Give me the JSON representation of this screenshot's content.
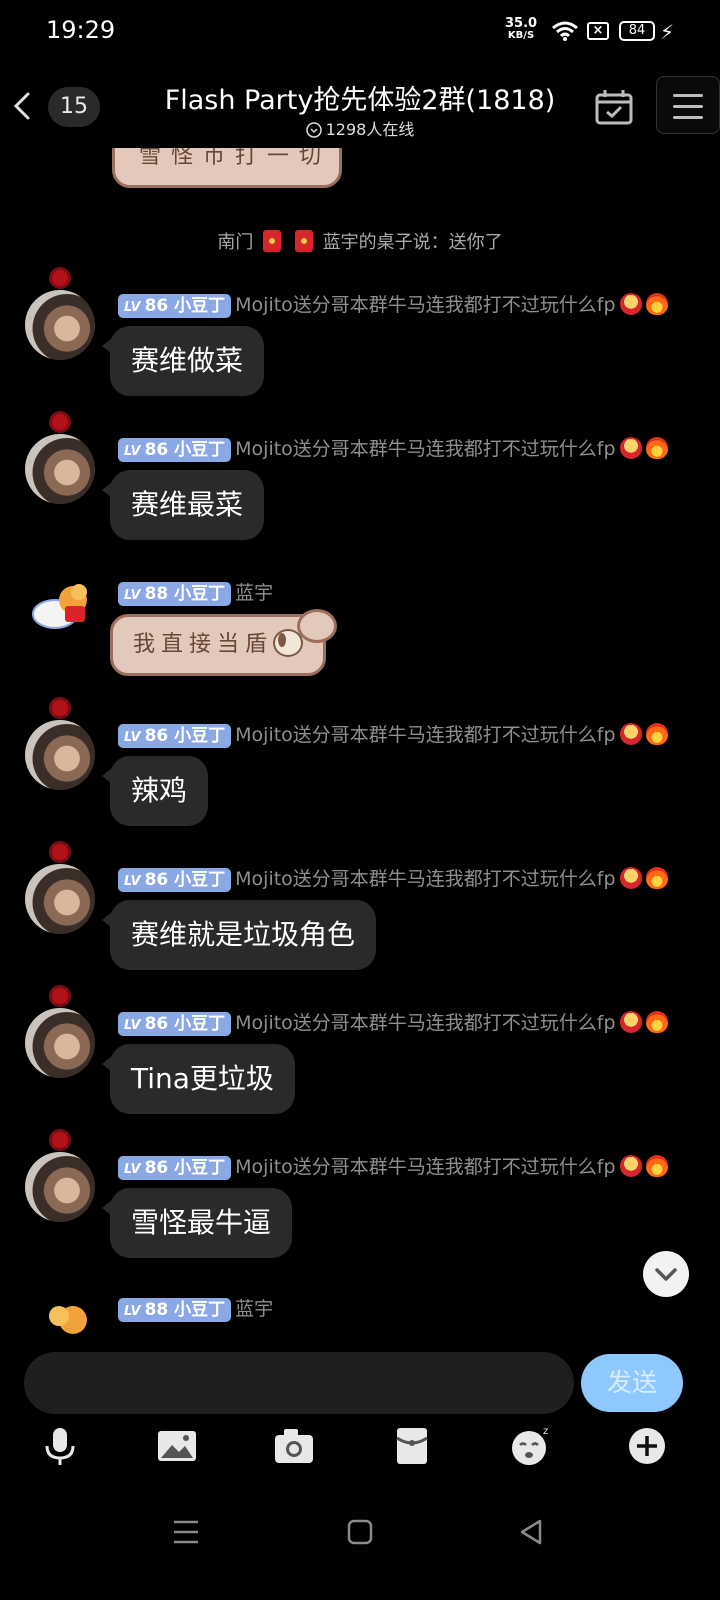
{
  "status": {
    "time": "19:29",
    "net_speed": "35.0",
    "net_unit": "KB/S",
    "battery": "84"
  },
  "header": {
    "back_count": "15",
    "title": "Flash Party抢先体验2群(1818)",
    "online": "1298人在线"
  },
  "chat": {
    "top_sticker_text": "雪怪币打一切",
    "notice": {
      "prefix": "南门",
      "text": "蓝宇的桌子说：送你了"
    },
    "messages": [
      {
        "level": "86",
        "title": "小豆丁",
        "name": "Mojito送分哥本群牛马连我都打不过玩什么fp",
        "text": "赛维做菜"
      },
      {
        "level": "86",
        "title": "小豆丁",
        "name": "Mojito送分哥本群牛马连我都打不过玩什么fp",
        "text": "赛维最菜"
      },
      {
        "level": "88",
        "title": "小豆丁",
        "name": "蓝宇",
        "text": "我直接当盾"
      },
      {
        "level": "86",
        "title": "小豆丁",
        "name": "Mojito送分哥本群牛马连我都打不过玩什么fp",
        "text": "辣鸡"
      },
      {
        "level": "86",
        "title": "小豆丁",
        "name": "Mojito送分哥本群牛马连我都打不过玩什么fp",
        "text": "赛维就是垃圾角色"
      },
      {
        "level": "86",
        "title": "小豆丁",
        "name": "Mojito送分哥本群牛马连我都打不过玩什么fp",
        "text": "Tina更垃圾"
      },
      {
        "level": "86",
        "title": "小豆丁",
        "name": "Mojito送分哥本群牛马连我都打不过玩什么fp",
        "text": "雪怪最牛逼"
      },
      {
        "level": "88",
        "title": "小豆丁",
        "name": "蓝宇"
      }
    ]
  },
  "input": {
    "value": "",
    "send_label": "发送"
  },
  "toolbar": {
    "icons": [
      "microphone-icon",
      "image-icon",
      "camera-icon",
      "red-packet-icon",
      "emoji-icon",
      "plus-icon"
    ]
  },
  "colors": {
    "background": "#000000",
    "bubble": "#2a2a2a",
    "level_badge": "#8aa7e6",
    "send_button": "#8fc7ff"
  }
}
